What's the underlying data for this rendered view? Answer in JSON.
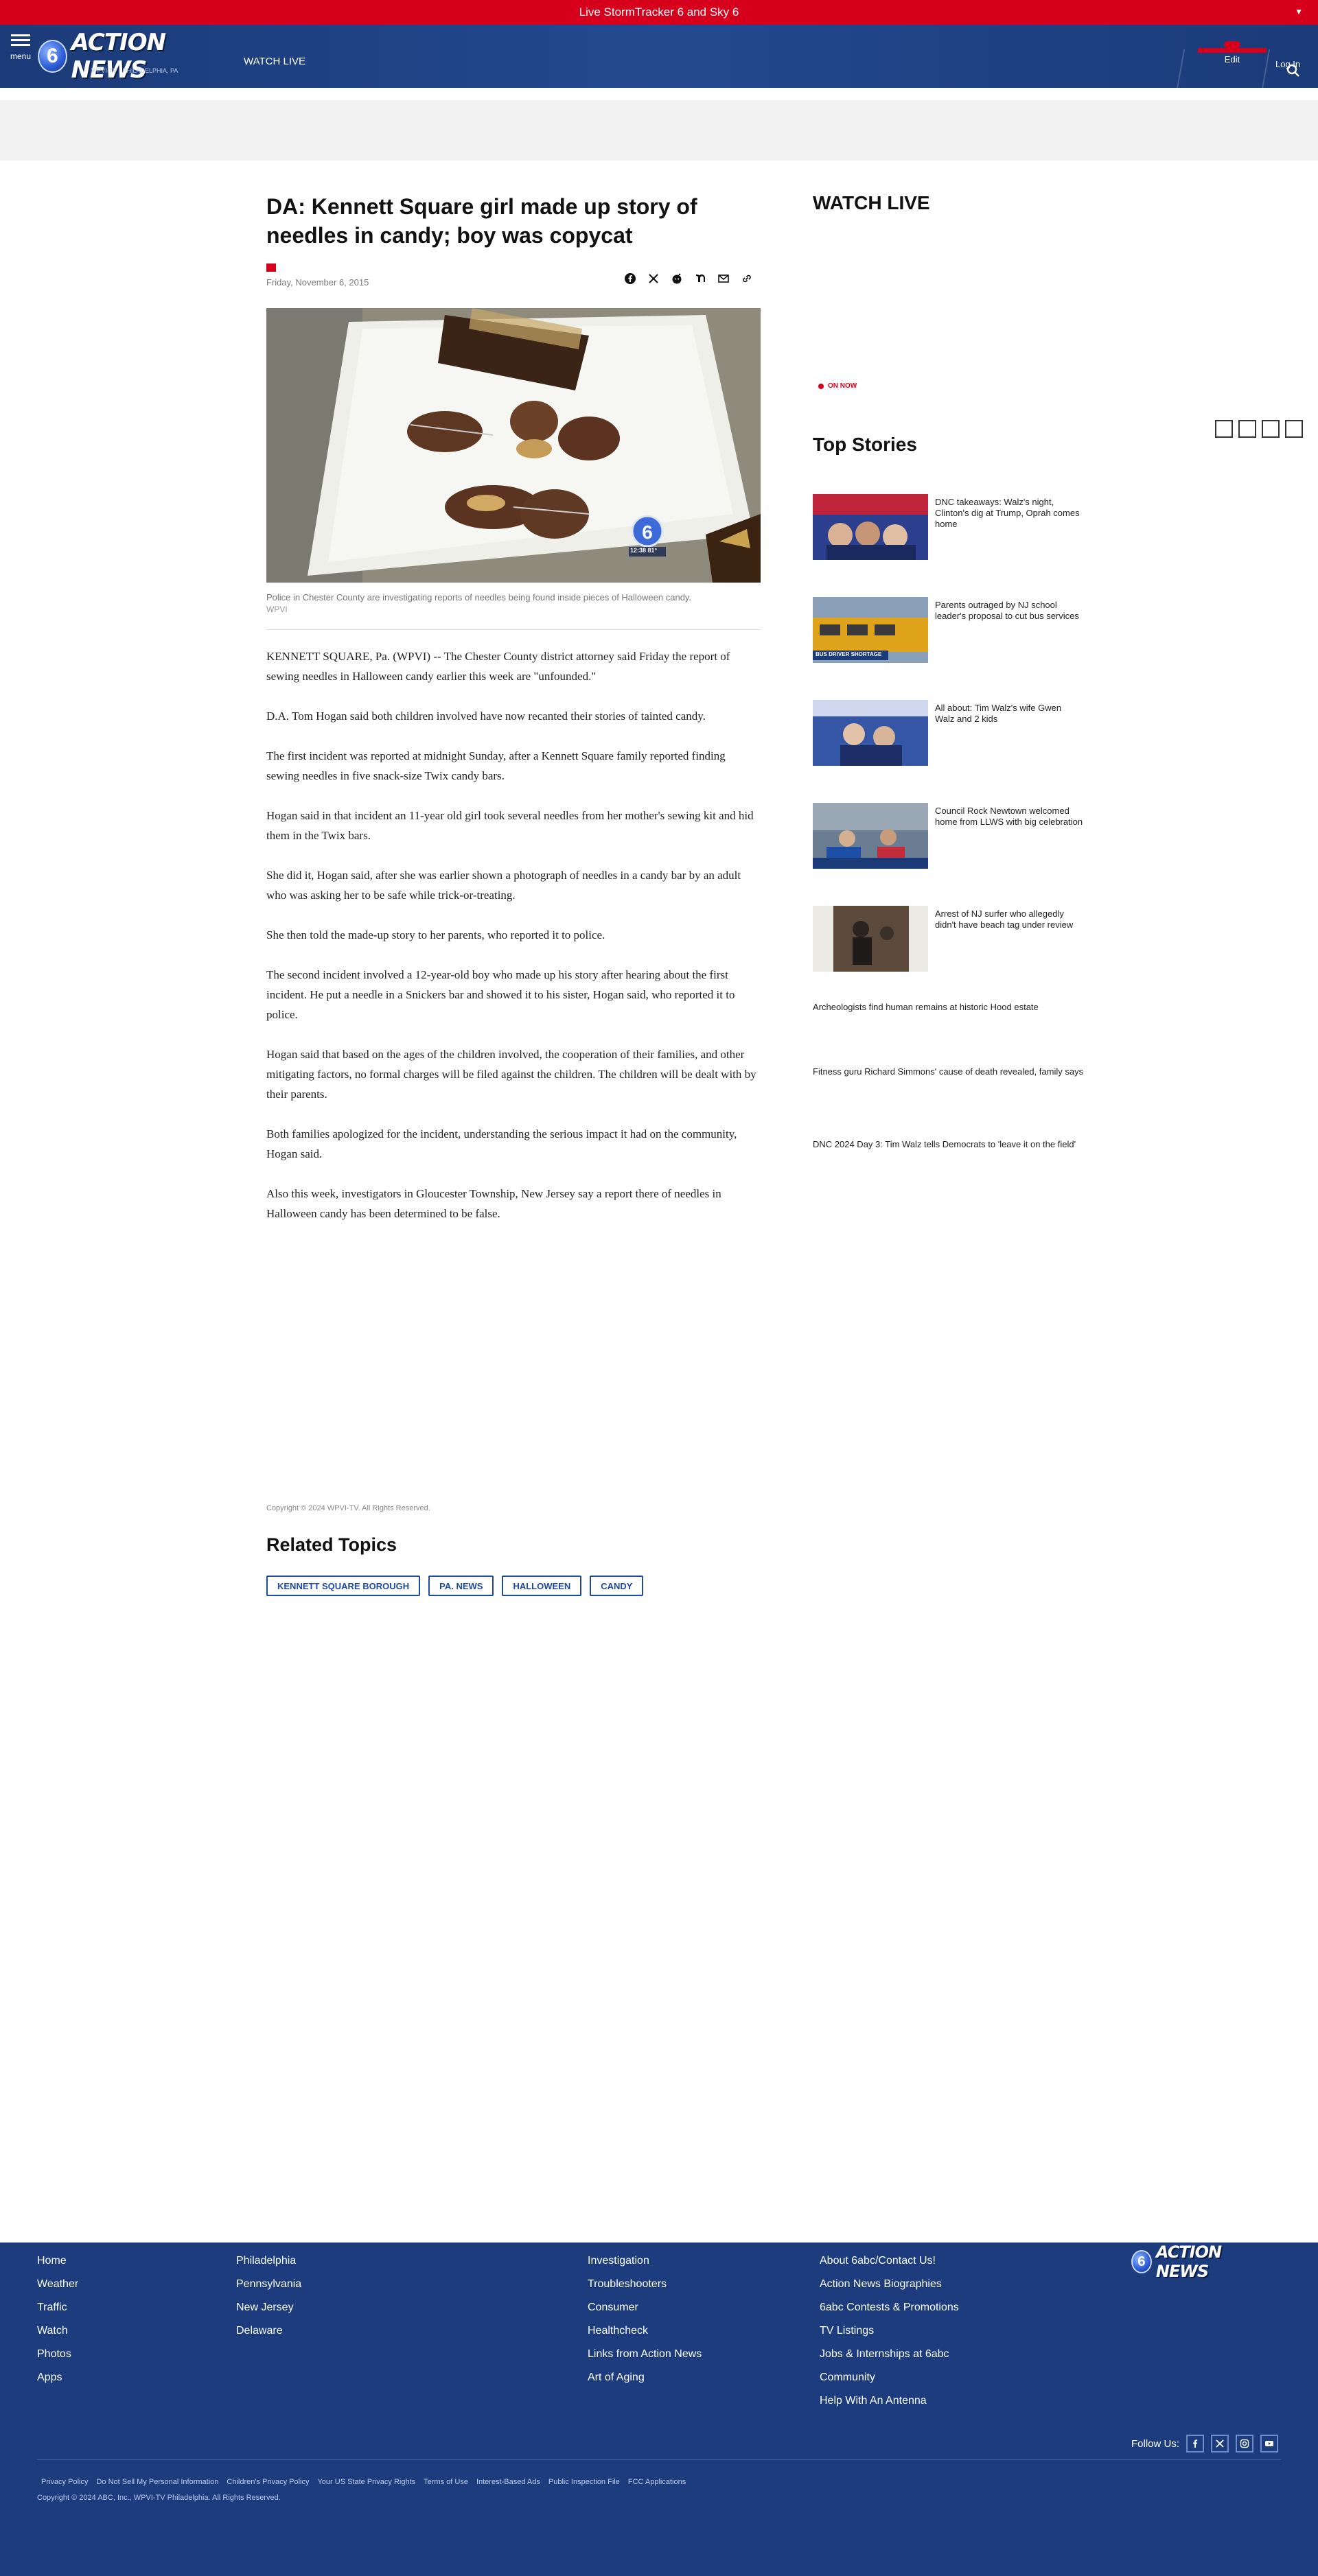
{
  "alert": {
    "text": "Live StormTracker 6 and Sky 6"
  },
  "header": {
    "menu_label": "menu",
    "logo_text": "ACTION NEWS",
    "logo_number": "6",
    "logo_sub": "WPVI-TV · PHILADELPHIA, PA",
    "watch_live": "WATCH LIVE",
    "weather_label": "Edit",
    "login": "Log In"
  },
  "article": {
    "headline": "DA: Kennett Square girl made up story of needles in candy; boy was copycat",
    "date": "Friday, November 6, 2015",
    "share_icons": [
      "facebook-icon",
      "x-icon",
      "reddit-icon",
      "nextdoor-icon",
      "email-icon",
      "link-icon"
    ],
    "caption": "Police in Chester County are investigating reports of needles being found inside pieces of Halloween candy.",
    "caption_credit": "WPVI",
    "bug_timestamp": "12:38 81°",
    "paragraphs": [
      "KENNETT SQUARE, Pa. (WPVI) -- The Chester County district attorney said Friday the report of sewing needles in Halloween candy earlier this week are \"unfounded.\"",
      "D.A. Tom Hogan said both children involved have now recanted their stories of tainted candy.",
      "The first incident was reported at midnight Sunday, after a Kennett Square family reported finding sewing needles in five snack-size Twix candy bars.",
      "Hogan said in that incident an 11-year old girl took several needles from her mother's sewing kit and hid them in the Twix bars.",
      "She did it, Hogan said, after she was earlier shown a photograph of needles in a candy bar by an adult who was asking her to be safe while trick-or-treating.",
      "She then told the made-up story to her parents, who reported it to police.",
      "The second incident involved a 12-year-old boy who made up his story after hearing about the first incident. He put a needle in a Snickers bar and showed it to his sister, Hogan said, who reported it to police.",
      "Hogan said that based on the ages of the children involved, the cooperation of their families, and other mitigating factors, no formal charges will be filed against the children. The children will be dealt with by their parents.",
      "Both families apologized for the incident, understanding the serious impact it had on the community, Hogan said.",
      "Also this week, investigators in Gloucester Township, New Jersey say a report there of needles in Halloween candy has been determined to be false."
    ],
    "copyright": "Copyright © 2024 WPVI-TV. All Rights Reserved.",
    "related_title": "Related Topics",
    "related_tags": [
      "KENNETT SQUARE BOROUGH",
      "PA. NEWS",
      "HALLOWEEN",
      "CANDY"
    ]
  },
  "sidebar": {
    "watch_live_title": "WATCH LIVE",
    "on_now": "ON NOW",
    "top_stories_title": "Top Stories",
    "stories": [
      {
        "text": "DNC takeaways: Walz's night, Clinton's dig at Trump, Oprah comes home"
      },
      {
        "text": "Parents outraged by NJ school leader's proposal to cut bus services",
        "thumb_label": "BUS DRIVER SHORTAGE"
      },
      {
        "text": "All about: Tim Walz's wife Gwen Walz and 2 kids"
      },
      {
        "text": "Council Rock Newtown welcomed home from LLWS with big celebration"
      },
      {
        "text": "Arrest of NJ surfer who allegedly didn't have beach tag under review"
      }
    ],
    "text_stories": [
      "Archeologists find human remains at historic Hood estate",
      "Fitness guru Richard Simmons' cause of death revealed, family says",
      "DNC 2024 Day 3: Tim Walz tells Democrats to 'leave it on the field'"
    ]
  },
  "footer": {
    "col1": [
      "Home",
      "Weather",
      "Traffic",
      "Watch",
      "Photos",
      "Apps"
    ],
    "col2": [
      "Philadelphia",
      "Pennsylvania",
      "New Jersey",
      "Delaware"
    ],
    "col3": [
      "Investigation",
      "Troubleshooters",
      "Consumer",
      "Healthcheck",
      "Links from Action News",
      "Art of Aging"
    ],
    "col4": [
      "About 6abc/Contact Us!",
      "Action News Biographies",
      "6abc Contests & Promotions",
      "TV Listings",
      "Jobs & Internships at 6abc",
      "Community",
      "Help With An Antenna"
    ],
    "logo_text": "ACTION NEWS",
    "logo_number": "6",
    "follow_us": "Follow Us:",
    "legal": [
      "Privacy Policy",
      "Do Not Sell My Personal Information",
      "Children's Privacy Policy",
      "Your US State Privacy Rights",
      "Terms of Use",
      "Interest-Based Ads",
      "Public Inspection File",
      "FCC Applications"
    ],
    "copyright": "Copyright © 2024 ABC, Inc., WPVI-TV Philadelphia. All Rights Reserved."
  },
  "colors": {
    "alert_red": "#d6001c",
    "header_blue": "#1b3a78",
    "footer_blue": "#1c3c7e",
    "tag_blue": "#1f4aa1"
  }
}
